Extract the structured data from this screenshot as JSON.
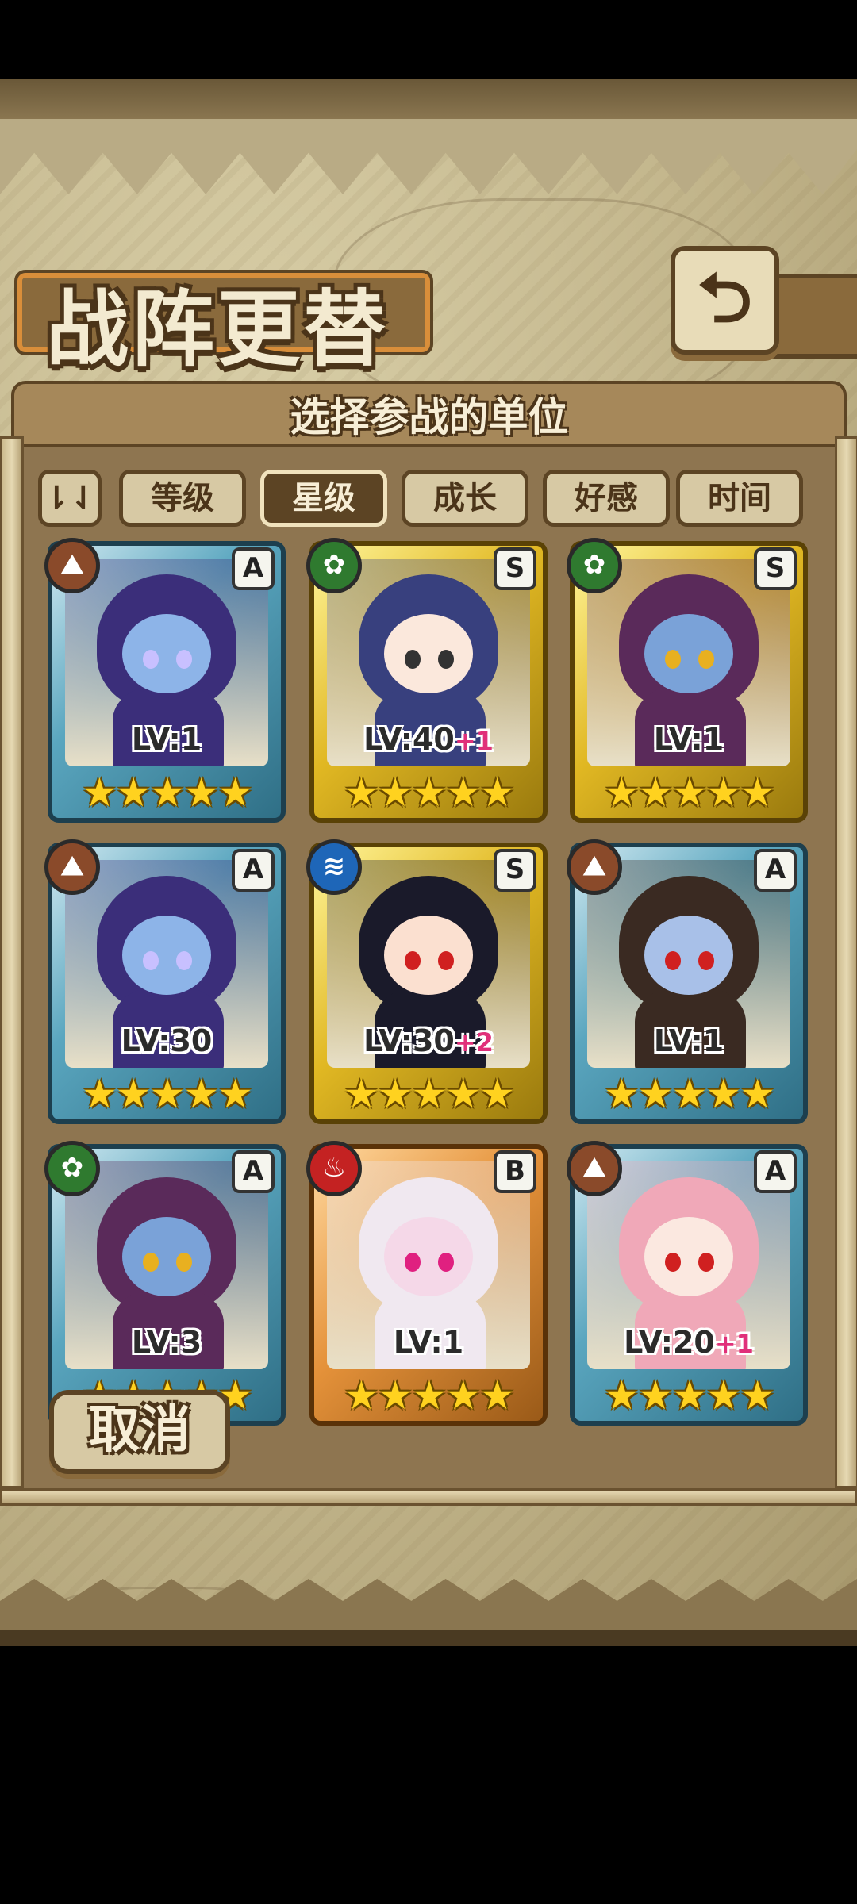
{
  "title": "战阵更替",
  "back_icon": "back-arrow-icon",
  "panel": {
    "header": "选择参战的单位"
  },
  "sort_button": {
    "label": "⇂⇃",
    "icon": "sort-order-icon"
  },
  "tabs": [
    {
      "label": "等级",
      "active": false
    },
    {
      "label": "星级",
      "active": true
    },
    {
      "label": "成长",
      "active": false
    },
    {
      "label": "好感",
      "active": false
    },
    {
      "label": "时间",
      "active": false
    }
  ],
  "units": [
    {
      "rank": "A",
      "element": "earth",
      "element_icon": "earth-element-icon",
      "level": "LV:1",
      "plus": "",
      "stars": "★★★★★",
      "frame": "blue",
      "hair": "#3b2e7a",
      "skin": "#8db4e8",
      "eye": "#c8c0ff"
    },
    {
      "rank": "S",
      "element": "wind",
      "element_icon": "wind-element-icon",
      "level": "LV:40",
      "plus": "+1",
      "stars": "★★★★★",
      "frame": "gold",
      "hair": "#38407e",
      "skin": "#fbe8dc",
      "eye": "#333333"
    },
    {
      "rank": "S",
      "element": "wind",
      "element_icon": "wind-element-icon",
      "level": "LV:1",
      "plus": "",
      "stars": "★★★★★",
      "frame": "gold",
      "hair": "#5a2a5a",
      "skin": "#7aa2d8",
      "eye": "#e8b020"
    },
    {
      "rank": "A",
      "element": "earth",
      "element_icon": "earth-element-icon",
      "level": "LV:30",
      "plus": "",
      "stars": "★★★★★",
      "frame": "blue",
      "hair": "#3b2e7a",
      "skin": "#8db4e8",
      "eye": "#c8c0ff"
    },
    {
      "rank": "S",
      "element": "water",
      "element_icon": "water-element-icon",
      "level": "LV:30",
      "plus": "+2",
      "stars": "★★★★★",
      "frame": "gold",
      "hair": "#1a1a2a",
      "skin": "#fbe0d0",
      "eye": "#d02020"
    },
    {
      "rank": "A",
      "element": "earth",
      "element_icon": "earth-element-icon",
      "level": "LV:1",
      "plus": "",
      "stars": "★★★★★",
      "frame": "blue",
      "hair": "#3a2a22",
      "skin": "#a8c0e8",
      "eye": "#d02020"
    },
    {
      "rank": "A",
      "element": "wind",
      "element_icon": "wind-element-icon",
      "level": "LV:3",
      "plus": "",
      "stars": "★★★★★",
      "frame": "blue",
      "hair": "#5a2a5a",
      "skin": "#7aa2d8",
      "eye": "#e8b020"
    },
    {
      "rank": "B",
      "element": "fire",
      "element_icon": "fire-element-icon",
      "level": "LV:1",
      "plus": "",
      "stars": "★★★★★",
      "frame": "orange",
      "hair": "#f0e8f0",
      "skin": "#f5d8e8",
      "eye": "#e02080"
    },
    {
      "rank": "A",
      "element": "earth",
      "element_icon": "earth-element-icon",
      "level": "LV:20",
      "plus": "+1",
      "stars": "★★★★★",
      "frame": "blue",
      "hair": "#f0a8b8",
      "skin": "#fbe8e0",
      "eye": "#d02020"
    }
  ],
  "cancel_button": {
    "label": "取消"
  }
}
